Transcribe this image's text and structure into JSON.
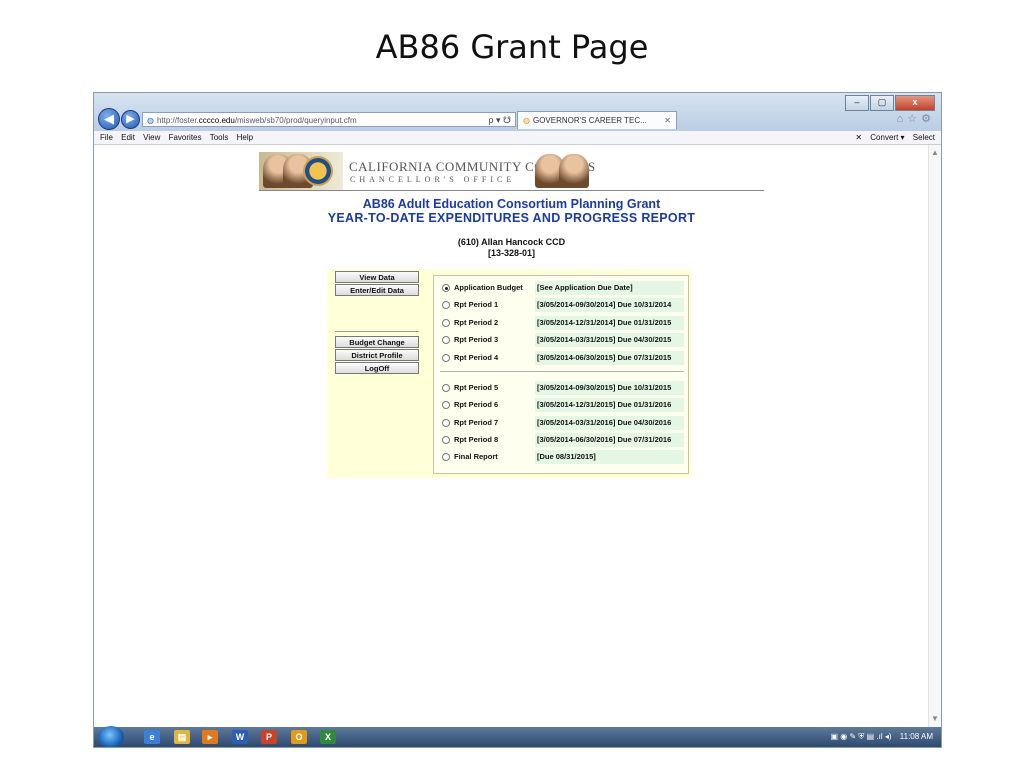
{
  "slide": {
    "title": "AB86 Grant Page"
  },
  "browser": {
    "address_prefix": "http://foster.",
    "address_domain": "cccco.edu",
    "address_path": "/misweb/sb70/prod/queryinput.cfm",
    "address_controls": "ρ ▾ ☋",
    "tab_title": "GOVERNOR'S CAREER TEC...",
    "tab_close": "✕",
    "menu": [
      "File",
      "Edit",
      "View",
      "Favorites",
      "Tools",
      "Help"
    ],
    "toolbar_right": {
      "close": "✕",
      "convert": "Convert ▾",
      "select": "Select"
    },
    "right_icons": "⌂☆⚙"
  },
  "window_controls": {
    "minimize": "–",
    "maximize": "▢",
    "close": "x"
  },
  "banner": {
    "line1": "CALIFORNIA COMMUNITY COLLEGES",
    "line2": "CHANCELLOR'S OFFICE"
  },
  "report": {
    "title_line1": "AB86 Adult Education Consortium Planning Grant",
    "title_line2": "YEAR-TO-DATE EXPENDITURES AND PROGRESS REPORT",
    "district_name": "(610)  Allan Hancock CCD",
    "district_code": "[13-328-01]"
  },
  "left_buttons": {
    "view_data": "View Data",
    "enter_edit": "Enter/Edit Data",
    "budget_change": "Budget Change",
    "district_profile": "District Profile",
    "logoff": "LogOff"
  },
  "periods": [
    {
      "label": "Application Budget",
      "dates": "[See Application Due Date]",
      "selected": true
    },
    {
      "label": "Rpt Period 1",
      "dates": "[3/05/2014-09/30/2014] Due 10/31/2014",
      "selected": false
    },
    {
      "label": "Rpt Period 2",
      "dates": "[3/05/2014-12/31/2014] Due 01/31/2015",
      "selected": false
    },
    {
      "label": "Rpt Period 3",
      "dates": "[3/05/2014-03/31/2015] Due 04/30/2015",
      "selected": false
    },
    {
      "label": "Rpt Period 4",
      "dates": "[3/05/2014-06/30/2015] Due 07/31/2015",
      "selected": false
    },
    {
      "label": "Rpt Period 5",
      "dates": "[3/05/2014-09/30/2015] Due 10/31/2015",
      "selected": false
    },
    {
      "label": "Rpt Period 6",
      "dates": "[3/05/2014-12/31/2015] Due 01/31/2016",
      "selected": false
    },
    {
      "label": "Rpt Period 7",
      "dates": "[3/05/2014-03/31/2016] Due 04/30/2016",
      "selected": false
    },
    {
      "label": "Rpt Period 8",
      "dates": "[3/05/2014-06/30/2016] Due 07/31/2016",
      "selected": false
    },
    {
      "label": "Final Report",
      "dates": "[Due 08/31/2015]",
      "selected": false
    }
  ],
  "taskbar": {
    "apps": [
      "e",
      "▤",
      "▸",
      "W",
      "P",
      "O",
      "X"
    ],
    "app_colors": [
      "#3b7fd6",
      "#e2b53c",
      "#e07a1c",
      "#2b5fb4",
      "#c8432a",
      "#e29a1a",
      "#2e8b3e"
    ],
    "clock": "11:08 AM"
  }
}
